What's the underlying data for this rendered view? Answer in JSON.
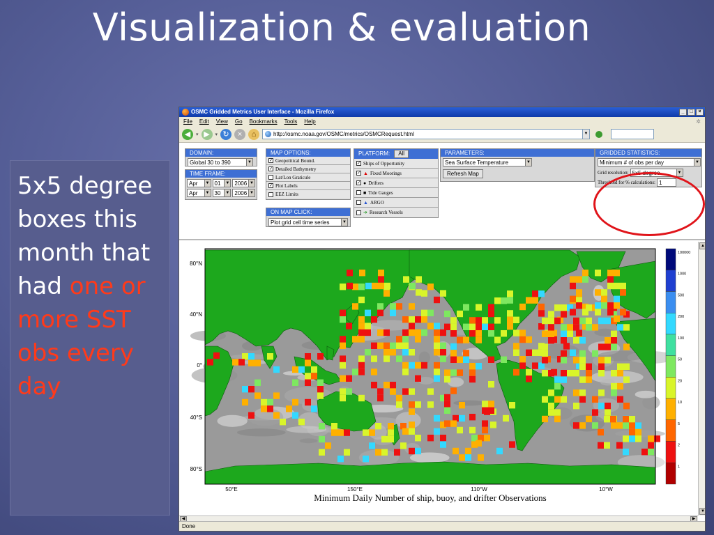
{
  "slide": {
    "title": "Visualization & evaluation",
    "side_text_1": "5x5 degree boxes this month that had ",
    "side_text_highlight": "one or more SST obs every day"
  },
  "browser": {
    "window_title": "OSMC Gridded Metrics User Interface - Mozilla Firefox",
    "menu": [
      "File",
      "Edit",
      "View",
      "Go",
      "Bookmarks",
      "Tools",
      "Help"
    ],
    "url": "http://osmc.noaa.gov/OSMC/metrics/OSMCRequest.html",
    "status": "Done"
  },
  "controls": {
    "domain": {
      "header": "DOMAIN:",
      "value": "Global 30 to 390"
    },
    "time_frame": {
      "header": "TIME FRAME:",
      "start": {
        "month": "Apr",
        "day": "01",
        "year": "2006"
      },
      "end": {
        "month": "Apr",
        "day": "30",
        "year": "2006"
      }
    },
    "map_options": {
      "header": "MAP OPTIONS:",
      "items": [
        {
          "label": "Geopolitical Bound.",
          "checked": true
        },
        {
          "label": "Detailed Bathymetry",
          "checked": true
        },
        {
          "label": "Lat/Lon Graticule",
          "checked": false
        },
        {
          "label": "Plot Labels",
          "checked": true
        },
        {
          "label": "EEZ Limits",
          "checked": false
        }
      ]
    },
    "on_map_click": {
      "header": "ON MAP CLICK:",
      "value": "Plot grid cell time series"
    },
    "platform": {
      "header": "PLATFORM:",
      "all_button": "All",
      "items": [
        {
          "label": "Ships of Opportunity",
          "checked": true,
          "marker": ""
        },
        {
          "label": "Fixed Moorings",
          "checked": true,
          "marker": "▲"
        },
        {
          "label": "Drifters",
          "checked": true,
          "marker": "●"
        },
        {
          "label": "Tide Gauges",
          "checked": false,
          "marker": "■"
        },
        {
          "label": "ARGO",
          "checked": false,
          "marker": "▲"
        },
        {
          "label": "Research Vessels",
          "checked": false,
          "marker": "➔"
        }
      ]
    },
    "parameters": {
      "header": "PARAMETERS:",
      "value": "Sea Surface Temperature",
      "refresh_button": "Refresh Map"
    },
    "gridded_statistics": {
      "header": "GRIDDED STATISTICS:",
      "value": "Minimum # of obs per day",
      "grid_resolution_label": "Grid resolution:",
      "grid_resolution_value": "5x5 degree",
      "threshold_label": "Threshold for % calculations:",
      "threshold_value": "1"
    }
  },
  "map": {
    "title": "Minimum Daily Number of ship, buoy, and drifter Observations",
    "lat_labels": [
      "80°N",
      "40°N",
      "0°",
      "40°S",
      "80°S"
    ],
    "lon_labels": [
      "50°E",
      "150°E",
      "110°W",
      "10°W"
    ],
    "legend": [
      {
        "label": "100000",
        "color": "#000a7a"
      },
      {
        "label": "1000",
        "color": "#1f3fd0"
      },
      {
        "label": "500",
        "color": "#3b8ef0"
      },
      {
        "label": "200",
        "color": "#33d9ff"
      },
      {
        "label": "100",
        "color": "#3fe0a0"
      },
      {
        "label": "50",
        "color": "#7ee860"
      },
      {
        "label": "20",
        "color": "#d9f52a"
      },
      {
        "label": "10",
        "color": "#ffb000"
      },
      {
        "label": "5",
        "color": "#ff6600"
      },
      {
        "label": "2",
        "color": "#ee1010"
      },
      {
        "label": "1",
        "color": "#b00000"
      }
    ],
    "colors": {
      "land": "#1da81d",
      "ocean": "#9a9a9a"
    }
  }
}
